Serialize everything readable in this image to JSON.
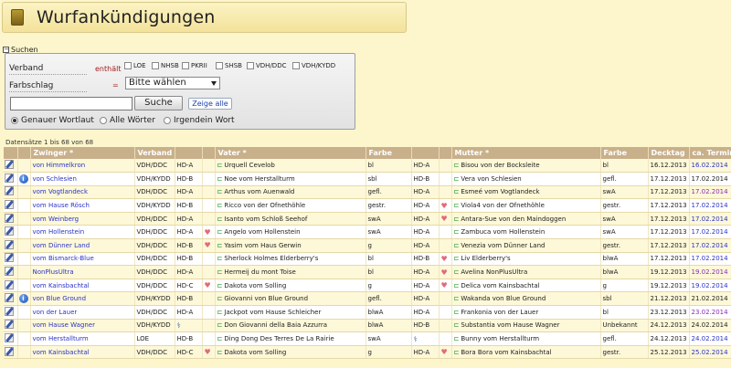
{
  "page": {
    "title": "Wurfankündigungen"
  },
  "search": {
    "toggle_label": "Suchen",
    "verband_label": "Verband",
    "verband_qualifier": "enthält",
    "checkboxes": [
      "LOE",
      "NHSB",
      "PKRII",
      "SHSB",
      "VDH/DDC",
      "VDH/KYDD"
    ],
    "farbschlag_label": "Farbschlag",
    "farbschlag_qualifier": "=",
    "farbschlag_value": "Bitte wählen",
    "search_button": "Suche",
    "show_all_button": "Zeige alle",
    "radios": [
      "Genauer Wortlaut",
      "Alle Wörter",
      "Irgendein Wort"
    ]
  },
  "records_text": "Datensätze 1 bis 68 von 68",
  "table": {
    "headers": {
      "zwinger": "Zwinger",
      "verband": "Verband",
      "vater": "Vater",
      "farbe1": "Farbe",
      "mutter": "Mutter",
      "farbe2": "Farbe",
      "decktag": "Decktag",
      "termin": "ca. Termin"
    },
    "rows": [
      {
        "zwinger": "von Himmelkron",
        "verband": "VDH/DDC",
        "hd1": "HD-A",
        "v_heart": false,
        "vater": "Urquell Cevelob",
        "farbe1": "bl",
        "hd2": "HD-A",
        "m_heart": false,
        "mutter": "Bisou von der Bocksleite",
        "farbe2": "bl",
        "decktag": "16.12.2013",
        "termin": "16.02.2014",
        "termin_color": "blue",
        "info": false,
        "dna": false
      },
      {
        "zwinger": "von Schlesien",
        "verband": "VDH/KYDD",
        "hd1": "HD-B",
        "v_heart": false,
        "vater": "Noe vom Herstallturm",
        "farbe1": "sbl",
        "hd2": "HD-B",
        "m_heart": false,
        "mutter": "Vera von Schlesien",
        "farbe2": "gefl.",
        "decktag": "17.12.2013",
        "termin": "17.02.2014",
        "termin_color": "normal",
        "info": true,
        "dna": false
      },
      {
        "zwinger": "vom Vogtlandeck",
        "verband": "VDH/DDC",
        "hd1": "HD-A",
        "v_heart": false,
        "vater": "Arthus vom Auenwald",
        "farbe1": "gefl.",
        "hd2": "HD-A",
        "m_heart": false,
        "mutter": "Esmeé vom Vogtlandeck",
        "farbe2": "swA",
        "decktag": "17.12.2013",
        "termin": "17.02.2014",
        "termin_color": "purple",
        "info": false,
        "dna": false
      },
      {
        "zwinger": "vom Hause Rösch",
        "verband": "VDH/KYDD",
        "hd1": "HD-B",
        "v_heart": false,
        "vater": "Ricco von der Ofnethöhle",
        "farbe1": "gestr.",
        "hd2": "HD-A",
        "m_heart": true,
        "mutter": "Viola4 von der Ofnethöhle",
        "farbe2": "gestr.",
        "decktag": "17.12.2013",
        "termin": "17.02.2014",
        "termin_color": "blue",
        "info": false,
        "dna": false
      },
      {
        "zwinger": "vom Weinberg",
        "verband": "VDH/DDC",
        "hd1": "HD-A",
        "v_heart": false,
        "vater": "Isanto vom Schloß Seehof",
        "farbe1": "swA",
        "hd2": "HD-A",
        "m_heart": true,
        "mutter": "Antara-Sue von den Maindoggen",
        "farbe2": "swA",
        "decktag": "17.12.2013",
        "termin": "17.02.2014",
        "termin_color": "blue",
        "info": false,
        "dna": false
      },
      {
        "zwinger": "vom Hollenstein",
        "verband": "VDH/DDC",
        "hd1": "HD-A",
        "v_heart": true,
        "vater": "Angelo vom Hollenstein",
        "farbe1": "swA",
        "hd2": "HD-A",
        "m_heart": false,
        "mutter": "Zambuca vom Hollenstein",
        "farbe2": "swA",
        "decktag": "17.12.2013",
        "termin": "17.02.2014",
        "termin_color": "blue",
        "info": false,
        "dna": false
      },
      {
        "zwinger": "vom Dünner Land",
        "verband": "VDH/DDC",
        "hd1": "HD-B",
        "v_heart": true,
        "vater": "Yasim vom Haus Gerwin",
        "farbe1": "g",
        "hd2": "HD-A",
        "m_heart": false,
        "mutter": "Venezia vom Dünner Land",
        "farbe2": "gestr.",
        "decktag": "17.12.2013",
        "termin": "17.02.2014",
        "termin_color": "blue",
        "info": false,
        "dna": false
      },
      {
        "zwinger": "vom Bismarck-Blue",
        "verband": "VDH/DDC",
        "hd1": "HD-B",
        "v_heart": false,
        "vater": "Sherlock Holmes Elderberry's",
        "farbe1": "bl",
        "hd2": "HD-B",
        "m_heart": true,
        "mutter": "Liv Elderberry's",
        "farbe2": "blwA",
        "decktag": "17.12.2013",
        "termin": "17.02.2014",
        "termin_color": "blue",
        "info": false,
        "dna": false
      },
      {
        "zwinger": "NonPlusUltra",
        "verband": "VDH/DDC",
        "hd1": "HD-A",
        "v_heart": false,
        "vater": "Hermeij du mont Toise",
        "farbe1": "bl",
        "hd2": "HD-A",
        "m_heart": true,
        "mutter": "Avelina NonPlusUltra",
        "farbe2": "blwA",
        "decktag": "19.12.2013",
        "termin": "19.02.2014",
        "termin_color": "purple",
        "info": false,
        "dna": false
      },
      {
        "zwinger": "vom Kainsbachtal",
        "verband": "VDH/DDC",
        "hd1": "HD-C",
        "v_heart": true,
        "vater": "Dakota vom Solling",
        "farbe1": "g",
        "hd2": "HD-A",
        "m_heart": true,
        "mutter": "Delica vom Kainsbachtal",
        "farbe2": "g",
        "decktag": "19.12.2013",
        "termin": "19.02.2014",
        "termin_color": "blue",
        "info": false,
        "dna": false
      },
      {
        "zwinger": "von Blue Ground",
        "verband": "VDH/KYDD",
        "hd1": "HD-B",
        "v_heart": false,
        "vater": "Giovanni von Blue Ground",
        "farbe1": "gefl.",
        "hd2": "HD-A",
        "m_heart": false,
        "mutter": "Wakanda von Blue Ground",
        "farbe2": "sbl",
        "decktag": "21.12.2013",
        "termin": "21.02.2014",
        "termin_color": "normal",
        "info": true,
        "dna": false
      },
      {
        "zwinger": "von der Lauer",
        "verband": "VDH/DDC",
        "hd1": "HD-A",
        "v_heart": false,
        "vater": "Jackpot vom Hause Schleicher",
        "farbe1": "blwA",
        "hd2": "HD-A",
        "m_heart": false,
        "mutter": "Frankonia von der Lauer",
        "farbe2": "bl",
        "decktag": "23.12.2013",
        "termin": "23.02.2014",
        "termin_color": "purple",
        "info": false,
        "dna": false
      },
      {
        "zwinger": "vom Hause Wagner",
        "verband": "VDH/KYDD",
        "hd1": "",
        "v_heart": false,
        "vater": "Don Giovanni della Baia Azzurra",
        "farbe1": "blwA",
        "hd2": "HD-B",
        "m_heart": false,
        "mutter": "Substantia vom Hause Wagner",
        "farbe2": "Unbekannt",
        "decktag": "24.12.2013",
        "termin": "24.02.2014",
        "termin_color": "normal",
        "info": false,
        "dna": true,
        "dna_pos": "hd1"
      },
      {
        "zwinger": "vom Herstallturm",
        "verband": "LOE",
        "hd1": "HD-B",
        "v_heart": false,
        "vater": "Ding Dong Des Terres De La Rairie",
        "farbe1": "swA",
        "hd2": "",
        "m_heart": false,
        "mutter": "Bunny vom Herstallturm",
        "farbe2": "gefl.",
        "decktag": "24.12.2013",
        "termin": "24.02.2014",
        "termin_color": "blue",
        "info": false,
        "dna": true,
        "dna_pos": "hd2"
      },
      {
        "zwinger": "vom Kainsbachtal",
        "verband": "VDH/DDC",
        "hd1": "HD-C",
        "v_heart": true,
        "vater": "Dakota vom Solling",
        "farbe1": "g",
        "hd2": "HD-A",
        "m_heart": true,
        "mutter": "Bora Bora vom Kainsbachtal",
        "farbe2": "gestr.",
        "decktag": "25.12.2013",
        "termin": "25.02.2014",
        "termin_color": "blue",
        "info": false,
        "dna": false
      }
    ]
  }
}
